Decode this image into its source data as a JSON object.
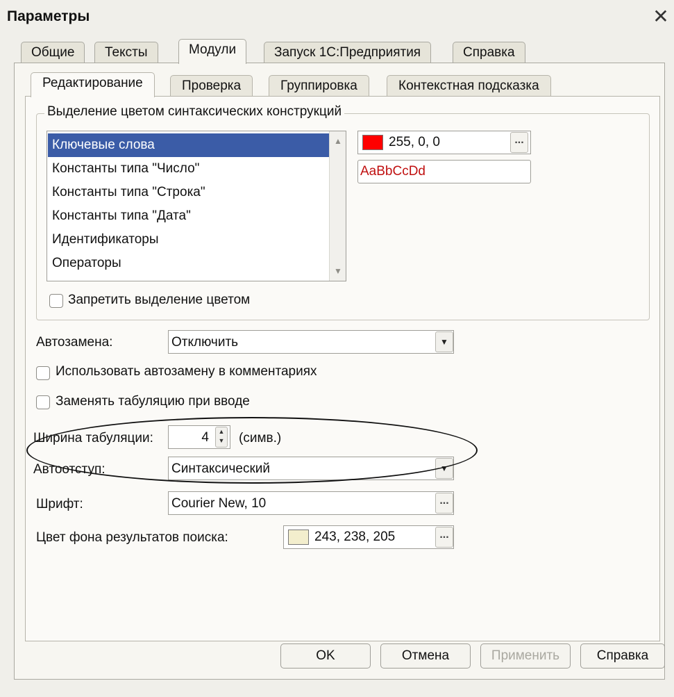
{
  "window": {
    "title": "Параметры",
    "close_glyph": "✕"
  },
  "main_tabs": [
    "Общие",
    "Тексты",
    "Модули",
    "Запуск 1С:Предприятия",
    "Справка"
  ],
  "sub_tabs": [
    "Редактирование",
    "Проверка",
    "Группировка",
    "Контекстная подсказка"
  ],
  "syntax_group": {
    "legend": "Выделение цветом синтаксических конструкций",
    "items": [
      "Ключевые слова",
      "Константы типа \"Число\"",
      "Константы типа \"Строка\"",
      "Константы типа \"Дата\"",
      "Идентификаторы",
      "Операторы"
    ],
    "selected_index": 0,
    "color_value": "255, 0, 0",
    "color_hex": "#ff0000",
    "font_sample": "AaBbCcDd",
    "font_sample_color": "#c01010",
    "disable_color_label": "Запретить выделение цветом"
  },
  "autoreplace": {
    "label": "Автозамена:",
    "value": "Отключить"
  },
  "use_autoreplace_comments": {
    "label": "Использовать автозамену в комментариях",
    "checked": false
  },
  "replace_tab": {
    "label": "Заменять табуляцию при вводе",
    "checked": false
  },
  "tab_width": {
    "label": "Ширина табуляции:",
    "value": "4",
    "unit": "(симв.)"
  },
  "autoindent": {
    "label": "Автоотступ:",
    "value": "Синтаксический"
  },
  "font": {
    "label": "Шрифт:",
    "value": "Courier New, 10"
  },
  "search_bg": {
    "label": "Цвет фона результатов поиска:",
    "value": "243, 238, 205",
    "swatch": "#f3eecd"
  },
  "buttons": {
    "ok": "OK",
    "cancel": "Отмена",
    "apply": "Применить",
    "help": "Справка"
  },
  "icons": {
    "ellipsis": "...",
    "dropdown": "▼",
    "spin_up": "▲",
    "spin_down": "▼",
    "scroll_up": "▲",
    "scroll_down": "▼"
  }
}
